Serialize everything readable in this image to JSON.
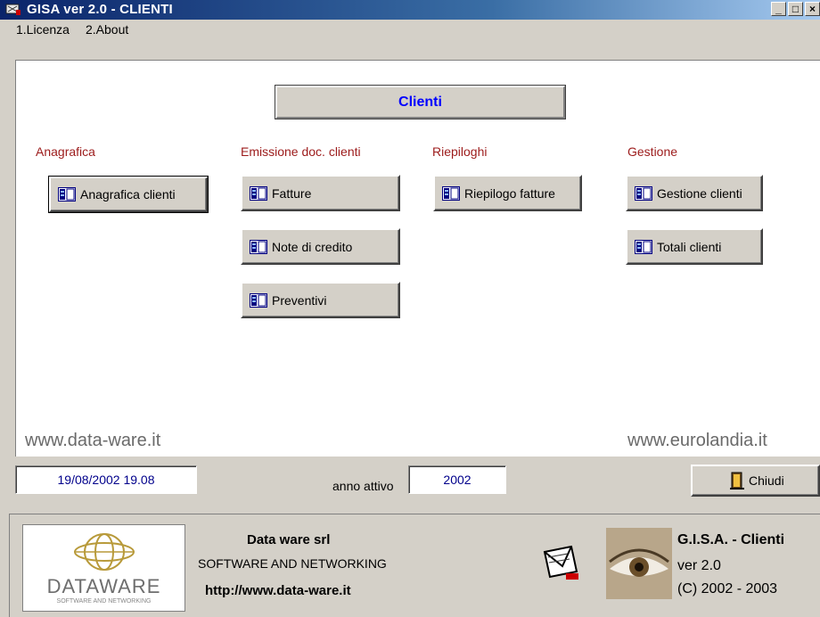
{
  "window": {
    "title": "GISA ver 2.0 - CLIENTI",
    "controls": {
      "minimize": "_",
      "maximize": "□",
      "close": "×"
    }
  },
  "menu": [
    {
      "label": "1.Licenza"
    },
    {
      "label": "2.About"
    }
  ],
  "main": {
    "heading": "Clienti",
    "sections": {
      "anagrafica": "Anagrafica",
      "emissione": "Emissione doc. clienti",
      "riepiloghi": "Riepiloghi",
      "gestione": "Gestione"
    },
    "buttons": {
      "anagrafica_clienti": "Anagrafica clienti",
      "fatture": "Fatture",
      "note_credito": "Note di credito",
      "preventivi": "Preventivi",
      "riepilogo_fatture": "Riepilogo fatture",
      "gestione_clienti": "Gestione clienti",
      "totali_clienti": "Totali clienti"
    },
    "url_left": "www.data-ware.it",
    "url_right": "www.eurolandia.it"
  },
  "status": {
    "datetime": "19/08/2002  19.08",
    "anno_label": "anno attivo",
    "anno_value": "2002",
    "close_button": "Chiudi"
  },
  "footer": {
    "logo_text": "DATAWARE",
    "logo_subtext": "SOFTWARE AND NETWORKING",
    "company_name": "Data ware srl",
    "company_tagline": "SOFTWARE AND NETWORKING",
    "company_url": "http://www.data-ware.it",
    "product_name": "G.I.S.A. - Clienti",
    "product_version": "ver 2.0",
    "product_copyright": "(C) 2002 - 2003"
  },
  "colors": {
    "titlebar": "#0a246a",
    "section_heading": "#9c1b1b",
    "heading_text": "#0000ff",
    "window_bg": "#d4d0c8"
  },
  "icons": {
    "app": "gisa-app-icon",
    "button": "window-panel-icon",
    "close": "door-exit-icon",
    "mail": "envelope-icon",
    "eye": "eye-photo-icon"
  }
}
